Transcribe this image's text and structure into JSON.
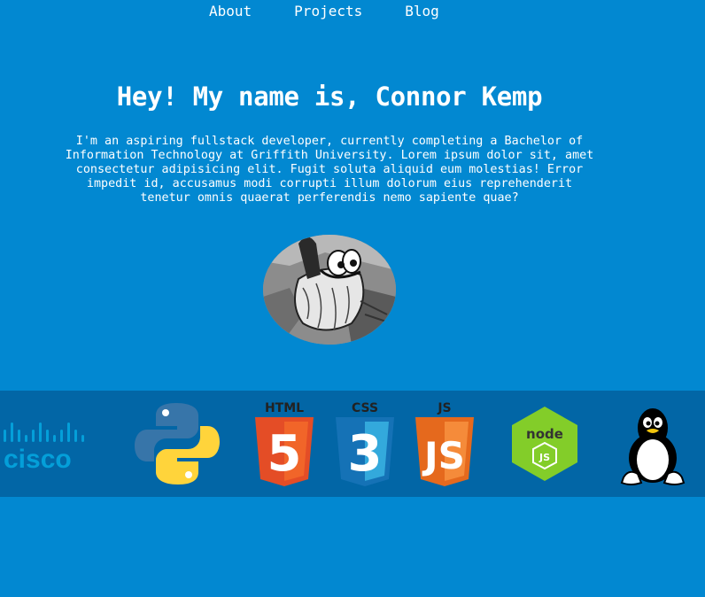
{
  "nav": {
    "items": [
      {
        "label": "About"
      },
      {
        "label": "Projects"
      },
      {
        "label": "Blog"
      }
    ]
  },
  "hero": {
    "title": "Hey! My name is, Connor Kemp",
    "description": "I'm an aspiring fullstack developer, currently completing a Bachelor of Information Technology at Griffith University. Lorem ipsum dolor sit, amet consectetur adipisicing elit. Fugit soluta aliquid eum molestias! Error impedit id, accusamus modi corrupti illum dolorum eius reprehenderit tenetur omnis quaerat perferendis nemo sapiente quae?"
  },
  "tech": {
    "cisco_label": "cisco",
    "html_label": "HTML",
    "html_number": "5",
    "css_label": "CSS",
    "css_number": "3",
    "js_label": "JS",
    "js_letters": "JS",
    "node_label": "node",
    "node_js": "JS"
  },
  "colors": {
    "background": "#0288d1",
    "strip": "#0266a6",
    "html": "#e44d26",
    "css": "#1572b6",
    "js": "#f0812b",
    "node": "#83cd29",
    "python_blue": "#3775a9",
    "python_yellow": "#ffd43b"
  }
}
